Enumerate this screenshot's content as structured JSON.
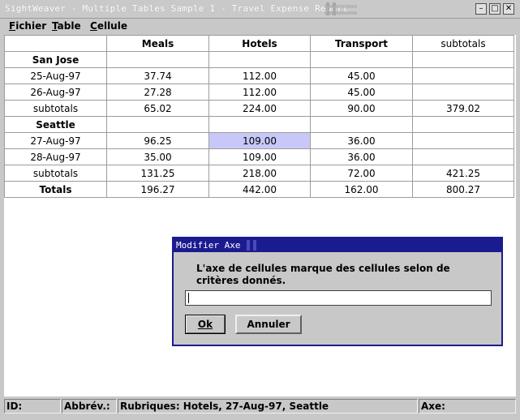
{
  "window": {
    "title": "SightWeaver - Multiple Tables Sample 1 - Travel Expense Report",
    "minimize_glyph": "–",
    "maximize_glyph": "□",
    "close_glyph": "✕"
  },
  "menu": {
    "items": [
      {
        "mnemonic": "F",
        "rest": "ichier"
      },
      {
        "mnemonic": "T",
        "rest": "able"
      },
      {
        "mnemonic": "C",
        "rest": "ellule"
      }
    ]
  },
  "table": {
    "headers": [
      "",
      "Meals",
      "Hotels",
      "Transport",
      "subtotals"
    ],
    "rows": [
      [
        "San Jose",
        "",
        "",
        "",
        ""
      ],
      [
        "25-Aug-97",
        "37.74",
        "112.00",
        "45.00",
        ""
      ],
      [
        "26-Aug-97",
        "27.28",
        "112.00",
        "45.00",
        ""
      ],
      [
        "subtotals",
        "65.02",
        "224.00",
        "90.00",
        "379.02"
      ],
      [
        "Seattle",
        "",
        "",
        "",
        ""
      ],
      [
        "27-Aug-97",
        "96.25",
        "109.00",
        "36.00",
        ""
      ],
      [
        "28-Aug-97",
        "35.00",
        "109.00",
        "36.00",
        ""
      ],
      [
        "subtotals",
        "131.25",
        "218.00",
        "72.00",
        "421.25"
      ],
      [
        "Totals",
        "196.27",
        "442.00",
        "162.00",
        "800.27"
      ]
    ]
  },
  "dialog": {
    "title": "Modifier Axe",
    "message": "L'axe de cellules marque des cellules selon de critères donnés.",
    "input_value": "",
    "ok_label": "Ok",
    "cancel_label": "Annuler"
  },
  "status": {
    "id": "ID:",
    "abbrev": "Abbrév.:",
    "rubriques": "Rubriques: Hotels, 27-Aug-97, Seattle",
    "axe": "Axe:"
  }
}
